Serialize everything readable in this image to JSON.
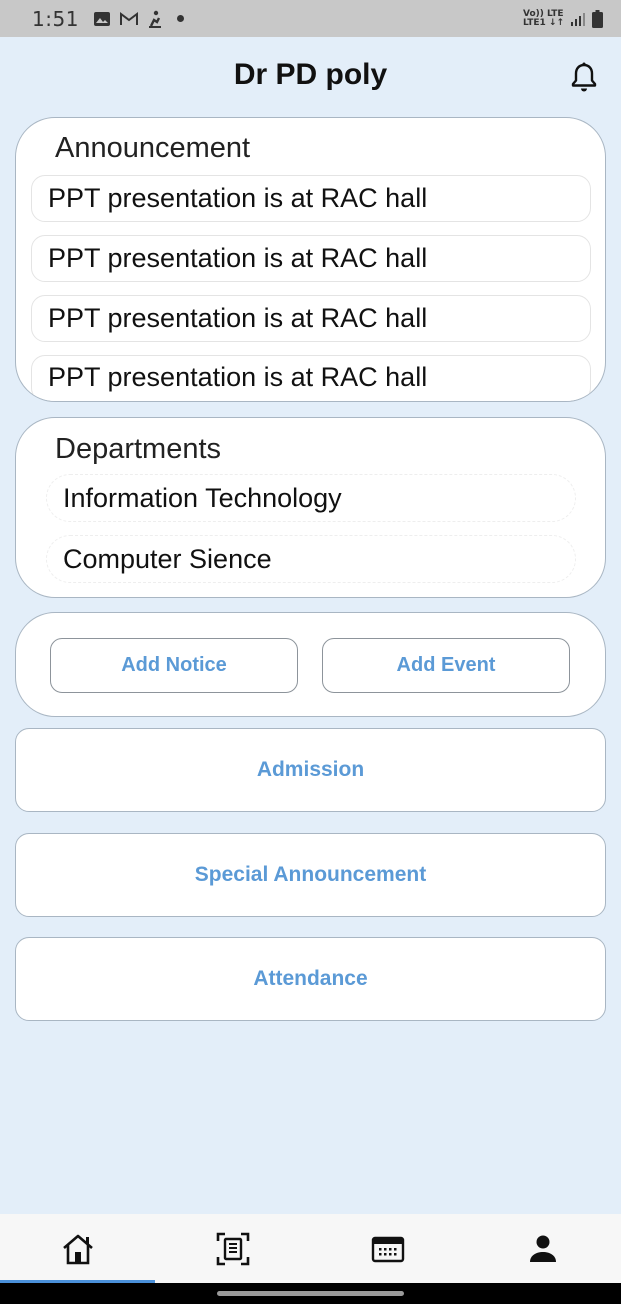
{
  "status_bar": {
    "time": "1:51",
    "icons": [
      "image-icon",
      "gmail-icon",
      "activity-icon"
    ],
    "network_top": "Vo)) LTE",
    "network_bottom": "LTE1 ↓↑"
  },
  "header": {
    "title": "Dr PD poly",
    "action_icon": "bell-icon"
  },
  "announcement": {
    "title": "Announcement",
    "items": [
      "PPT presentation is at RAC hall",
      "PPT presentation is at RAC hall",
      "PPT presentation is at RAC hall",
      "PPT presentation is at RAC hall"
    ]
  },
  "departments": {
    "title": "Departments",
    "items": [
      "Information Technology",
      "Computer Sience"
    ]
  },
  "actions": {
    "add_notice": "Add Notice",
    "add_event": "Add Event"
  },
  "menu": {
    "admission": "Admission",
    "special_announcement": "Special Announcement",
    "attendance": "Attendance"
  },
  "bottom_nav": {
    "items": [
      "home-icon",
      "document-scan-icon",
      "calendar-icon",
      "person-icon"
    ],
    "active_index": 0
  },
  "colors": {
    "background": "#e3eef9",
    "accent": "#5b9ad6",
    "nav_indicator": "#4a90d9"
  }
}
